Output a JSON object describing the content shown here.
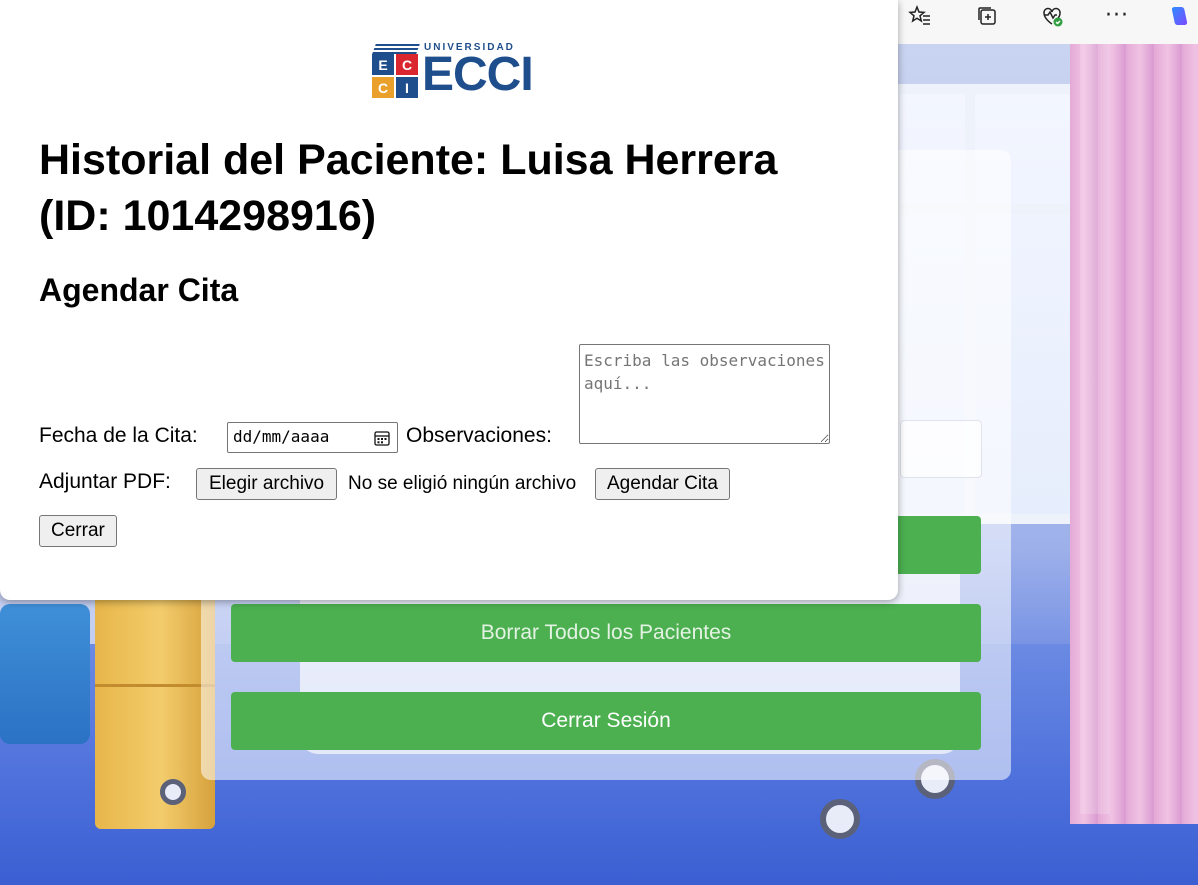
{
  "browser": {
    "icons": [
      "favorites-icon",
      "collections-icon",
      "browser-essentials-icon",
      "more-icon",
      "copilot-icon"
    ],
    "more_label": "···"
  },
  "background_panel": {
    "buttons": {
      "delete_all": "Borrar Todos los Pacientes",
      "logout": "Cerrar Sesión"
    },
    "button_color": "#4caf50"
  },
  "modal": {
    "logo": {
      "university_label": "UNIVERSIDAD",
      "name": "ECCI",
      "tiles": [
        "E",
        "C",
        "C",
        "I"
      ],
      "colors": {
        "blue": "#1f4e8c",
        "red": "#d9262f",
        "yellow": "#e9a12b"
      }
    },
    "title": "Historial del Paciente: Luisa Herrera (ID: 1014298916)",
    "section_title": "Agendar Cita",
    "form": {
      "date_label": "Fecha de la Cita:",
      "date_placeholder": "dd/mm/aaaa",
      "observations_label": "Observaciones:",
      "observations_placeholder": "Escriba las observaciones aquí...",
      "pdf_label": "Adjuntar PDF:",
      "file_button": "Elegir archivo",
      "file_status": "No se eligió ningún archivo",
      "submit_button": "Agendar Cita"
    },
    "close_button": "Cerrar"
  }
}
